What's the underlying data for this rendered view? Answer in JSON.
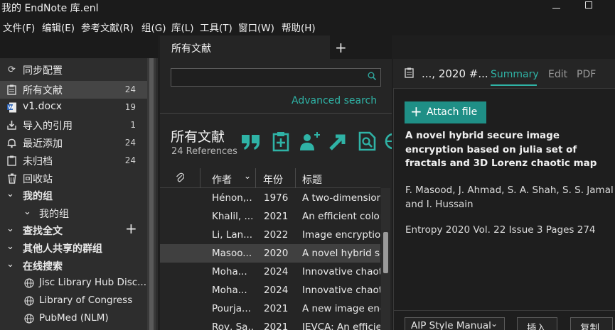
{
  "window": {
    "title": "我的 EndNote 库.enl"
  },
  "menu": [
    "文件(F)",
    "编辑(E)",
    "参考文献(R)",
    "组(G)",
    "库(L)",
    "工具(T)",
    "窗口(W)",
    "帮助(H)"
  ],
  "sidebar": {
    "items": [
      {
        "label": "同步配置",
        "icon": "sync-icon"
      },
      {
        "label": "所有文献",
        "count": "24",
        "icon": "clipboard-icon",
        "selected": true
      },
      {
        "label": "v1.docx",
        "count": "19",
        "icon": "word-doc-icon"
      },
      {
        "label": "导入的引用",
        "count": "1",
        "icon": "import-icon"
      },
      {
        "label": "最近添加",
        "count": "24",
        "icon": "bell-icon"
      },
      {
        "label": "未归档",
        "count": "24",
        "icon": "unfiled-icon"
      },
      {
        "label": "回收站",
        "icon": "trash-icon"
      }
    ],
    "groups": {
      "my_groups": "我的组",
      "my_groups_child": "我的组",
      "find_full_text": "查找全文",
      "shared_groups": "其他人共享的群组",
      "online_search": "在线搜索"
    },
    "online": [
      "Jisc Library Hub Disc...",
      "Library of Congress",
      "PubMed (NLM)"
    ]
  },
  "middle": {
    "tab": "所有文献",
    "search": {
      "placeholder": ""
    },
    "advanced_search": "Advanced search",
    "library_title": "所有文献",
    "reference_count": "24 References",
    "columns": {
      "author": "作者",
      "year": "年份",
      "title": "标题"
    },
    "rows": [
      {
        "author": "Hénon,...",
        "year": "1976",
        "title": "A two-dimensional"
      },
      {
        "author": "Khalil, ...",
        "year": "2021",
        "title": "An efficient color/"
      },
      {
        "author": "Li, Lan...",
        "year": "2022",
        "title": "Image encryption"
      },
      {
        "author": "Masoo...",
        "year": "2020",
        "title": "A novel hybrid sec",
        "selected": true
      },
      {
        "author": "Moha...",
        "year": "2024",
        "title": "Innovative chaotic"
      },
      {
        "author": "Moha...",
        "year": "2024",
        "title": "Innovative chaotic"
      },
      {
        "author": "Pourja...",
        "year": "2021",
        "title": "A new image encr"
      },
      {
        "author": "Roy, Sa...",
        "year": "2021",
        "title": "IEVCA: An efficien"
      }
    ]
  },
  "detail": {
    "header_title": "..., 2020 #...",
    "tabs": {
      "summary": "Summary",
      "edit": "Edit",
      "pdf": "PDF"
    },
    "attach_label": "Attach file",
    "title": "A novel hybrid secure image encryption based on julia set of fractals and 3D Lorenz chaotic map",
    "authors": "F. Masood, J. Ahmad, S. A. Shah, S. S. Jamal and I. Hussain",
    "source": "Entropy 2020 Vol. 22 Issue 3 Pages 274",
    "style": "AIP Style Manual",
    "insert_label": "插入",
    "copy_label": "复制"
  },
  "colors": {
    "accent": "#2fb3a6",
    "button": "#1f8f86"
  }
}
